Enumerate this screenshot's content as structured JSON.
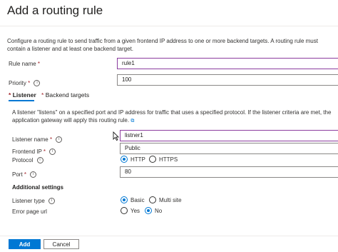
{
  "header": {
    "title": "Add a routing rule"
  },
  "description": "Configure a routing rule to send traffic from a given frontend IP address to one or more backend targets. A routing rule must contain a listener and at least one backend target.",
  "rule_name": {
    "label": "Rule name",
    "required_mark": "*",
    "value": "rule1"
  },
  "priority": {
    "label": "Priority",
    "required_mark": "*",
    "value": "100"
  },
  "tabs": [
    {
      "label": "Listener",
      "required_mark": "*"
    },
    {
      "label": "Backend targets",
      "required_mark": "*"
    }
  ],
  "listener": {
    "description": "A listener \"listens\" on a specified port and IP address for traffic that uses a specified protocol. If the listener criteria are met, the application gateway will apply this routing rule.",
    "listener_name": {
      "label": "Listener name",
      "required_mark": "*",
      "value": "listner1"
    },
    "frontend_ip": {
      "label": "Frontend IP",
      "required_mark": "*",
      "value": "Public"
    },
    "protocol": {
      "label": "Protocol",
      "options": [
        "HTTP",
        "HTTPS"
      ],
      "selected": "HTTP"
    },
    "port": {
      "label": "Port",
      "required_mark": "*",
      "value": "80"
    },
    "additional_settings": "Additional settings",
    "listener_type": {
      "label": "Listener type",
      "options": [
        "Basic",
        "Multi site"
      ],
      "selected": "Basic"
    },
    "error_page_url": {
      "label": "Error page url",
      "options": [
        "Yes",
        "No"
      ],
      "selected": "No"
    }
  },
  "footer": {
    "add_label": "Add",
    "cancel_label": "Cancel"
  },
  "icons": {
    "info": "info-icon",
    "external_link": "external-link-icon",
    "cursor": "mouse-cursor-icon"
  },
  "colors": {
    "accent": "#0078d4",
    "focus_border": "#8b3c9e",
    "required": "#a4262c"
  }
}
